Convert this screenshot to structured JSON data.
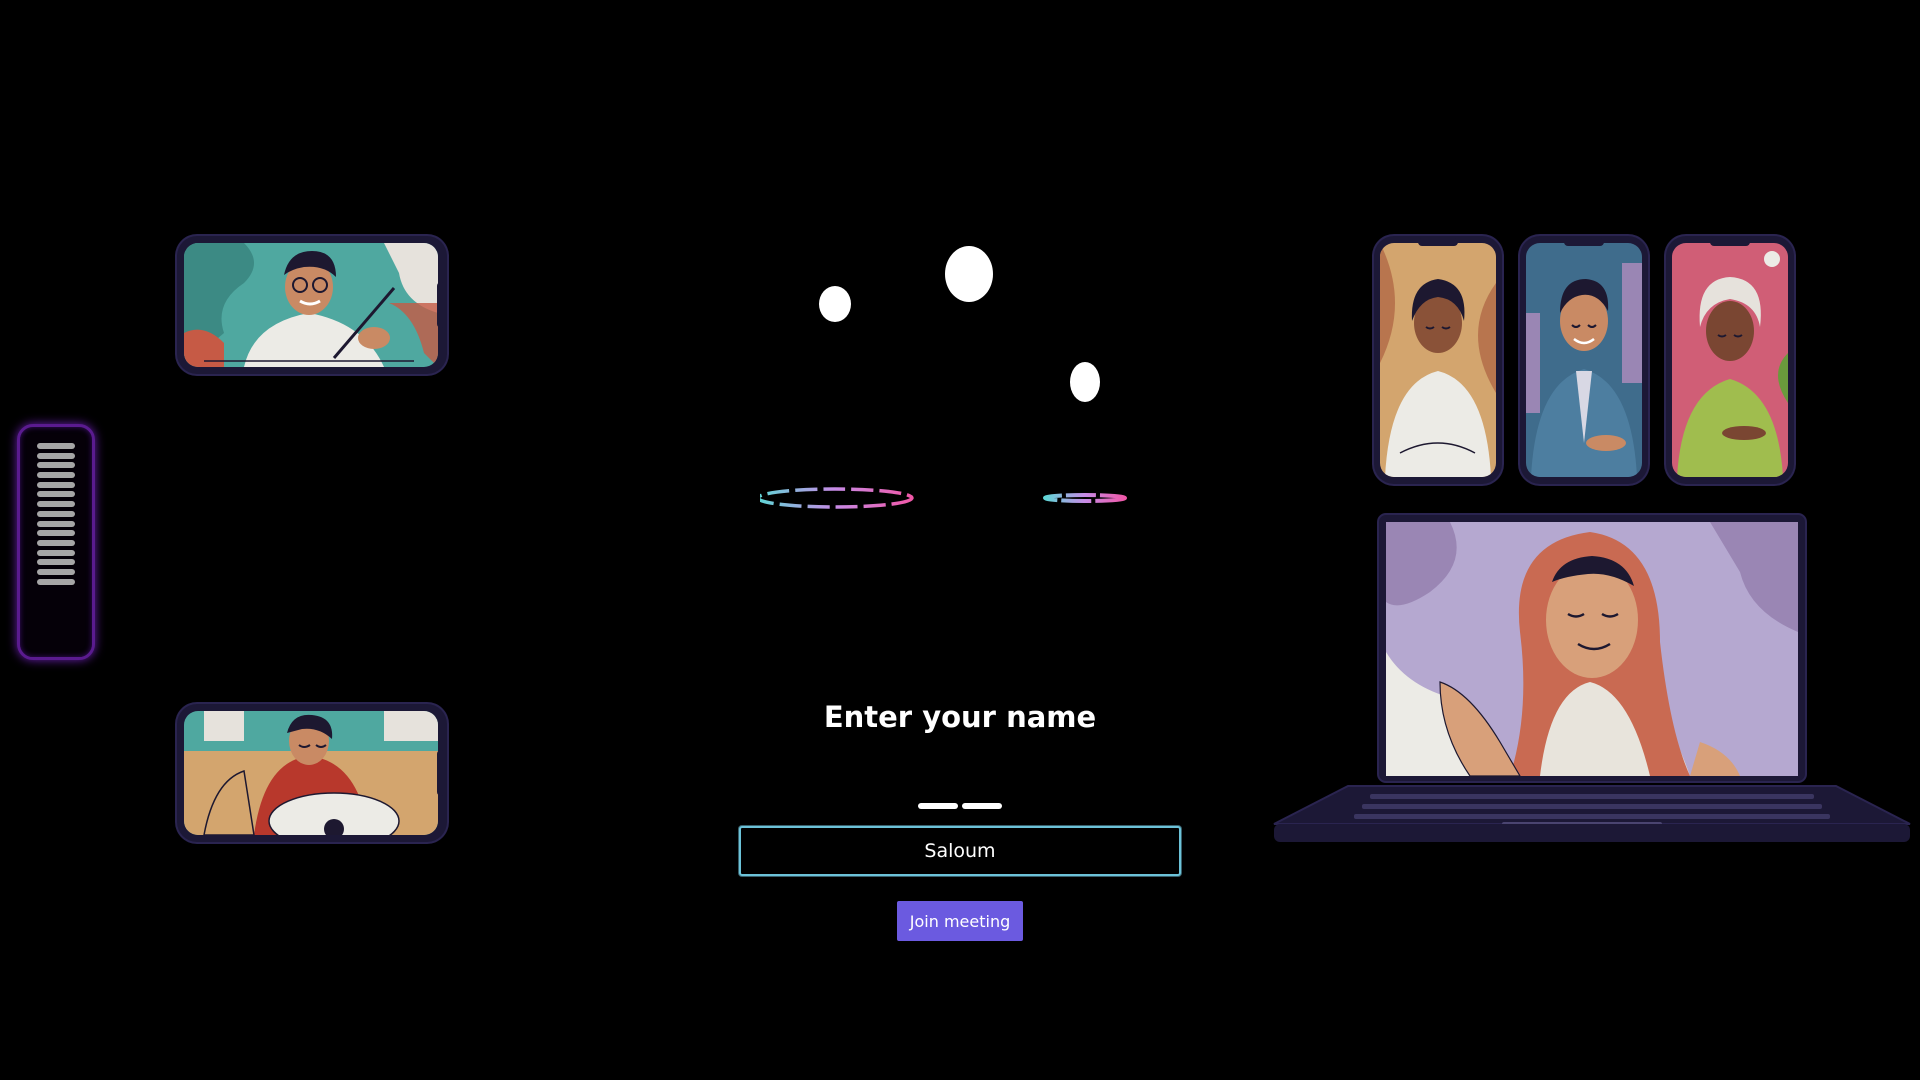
{
  "join": {
    "title": "Enter your name",
    "name_value": "Saloum",
    "name_placeholder": "",
    "join_label": "Join meeting"
  },
  "audio_level_meter": {
    "bar_count": 15
  },
  "colors": {
    "background": "#000000",
    "accent_button": "#6b5ae0",
    "input_border": "#6cc2d8",
    "meter_glow": "#6a1fb0",
    "device_frame": "#1c1836"
  },
  "illustrations": [
    {
      "name": "writer-call-illustration"
    },
    {
      "name": "guitarist-call-illustration"
    },
    {
      "name": "woman-call-illustration"
    },
    {
      "name": "man-tie-call-illustration"
    },
    {
      "name": "elder-call-illustration"
    },
    {
      "name": "laptop-hijab-call-illustration"
    }
  ]
}
